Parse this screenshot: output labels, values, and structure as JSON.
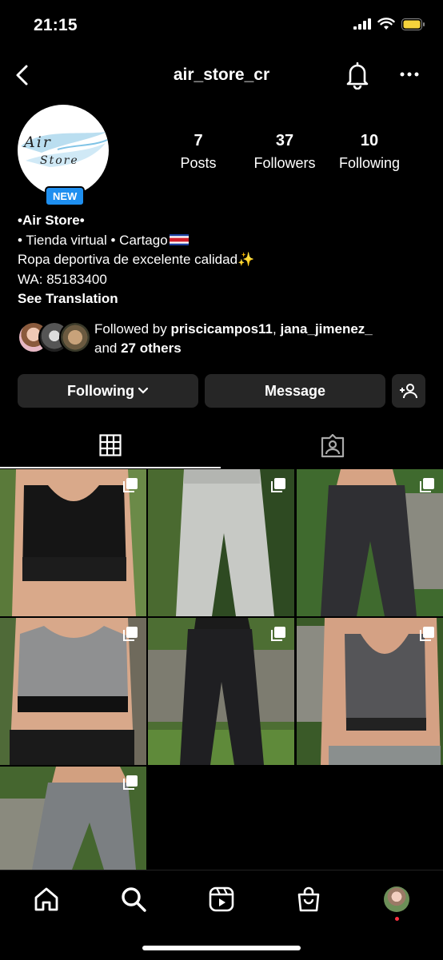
{
  "status_bar": {
    "time": "21:15"
  },
  "header": {
    "username": "air_store_cr"
  },
  "profile": {
    "logo_line1": "Air",
    "logo_line2": "Store",
    "badge": "NEW",
    "stats": [
      {
        "value": "7",
        "label": "Posts"
      },
      {
        "value": "37",
        "label": "Followers"
      },
      {
        "value": "10",
        "label": "Following"
      }
    ],
    "bio": {
      "name": "•Air Store•",
      "line1": "• Tienda virtual • Cartago",
      "line2": "Ropa deportiva de excelente calidad✨",
      "line3": "WA: 85183400",
      "see_translation": "See Translation"
    },
    "followed_by": {
      "prefix": "Followed by ",
      "user1": "priscicampos11",
      "sep": ", ",
      "user2": "jana_jimenez_",
      "and": "and ",
      "others": "27 others"
    }
  },
  "actions": {
    "following": "Following",
    "message": "Message"
  },
  "colors": {
    "badge": "#1e8ff0",
    "button_bg": "#262626",
    "notification_dot": "#ff3040"
  }
}
